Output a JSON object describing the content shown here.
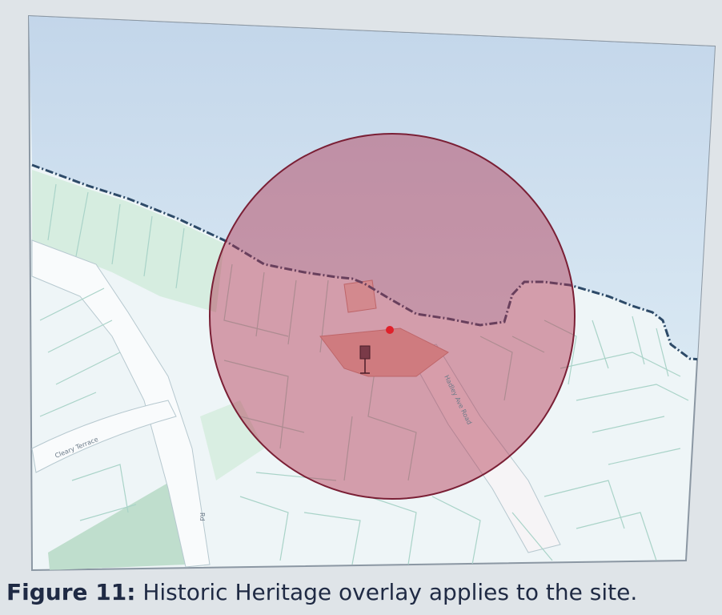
{
  "caption": {
    "label": "Figure 11:",
    "text": "Historic Heritage overlay applies to the site."
  },
  "map": {
    "road_labels": [
      "Cleary Terrace",
      "Hadley Ave Road",
      "Rd"
    ],
    "overlay_name": "",
    "colors": {
      "water": "#cfe1ef",
      "land": "#eef5f7",
      "parcel_lines": "#a9d3c8",
      "park": "#c9e6d6",
      "overlay_fill": "#b2324d",
      "overlay_stroke": "#7a1f35",
      "coastline": "#2d4a68",
      "site_marker": "#e0202a"
    },
    "icons": [
      "heritage-marker-icon",
      "site-point-icon"
    ]
  }
}
